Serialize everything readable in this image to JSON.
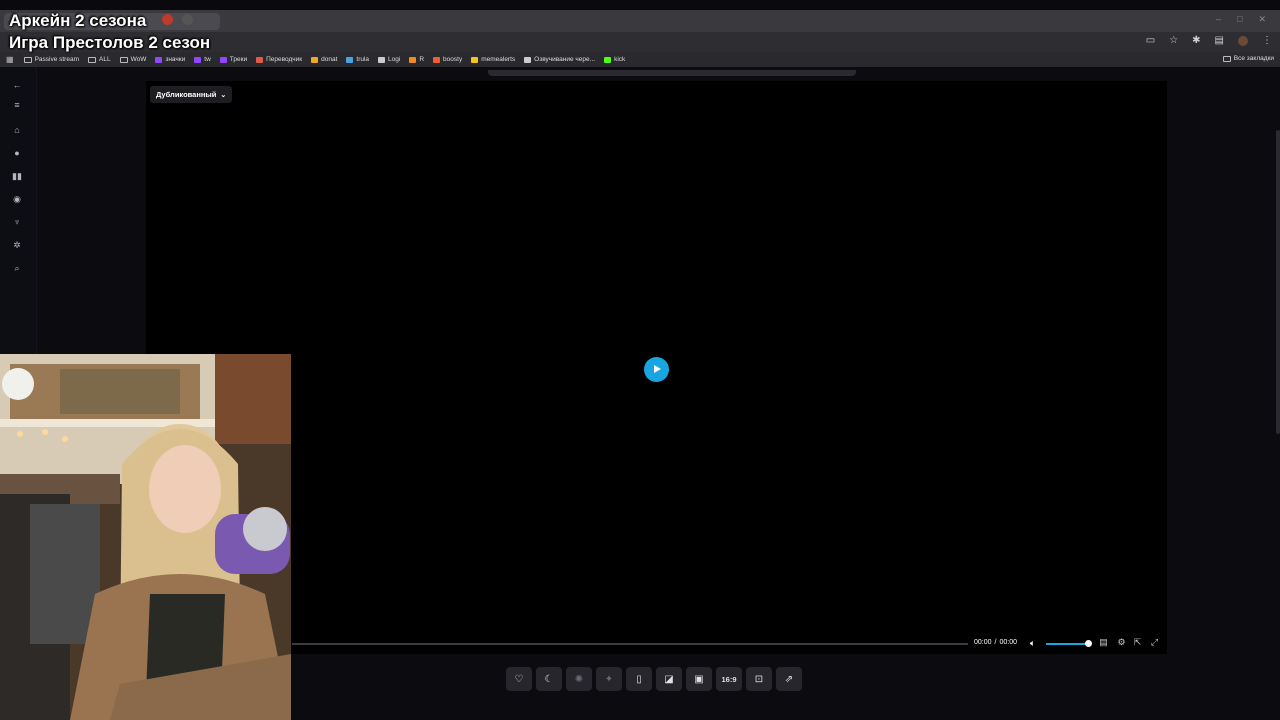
{
  "overlay": {
    "line1": "Аркейн 2 сезона",
    "line2": "Игра Престолов 2 сезон"
  },
  "browser": {
    "bookmarks": [
      {
        "label": "Passive stream",
        "icon": "folder-icon",
        "color": "#bbbbbb"
      },
      {
        "label": "ALL",
        "icon": "folder-icon",
        "color": "#bbbbbb"
      },
      {
        "label": "WoW",
        "icon": "folder-icon",
        "color": "#bbbbbb"
      },
      {
        "label": "значки",
        "icon": "twitch-icon",
        "color": "#9146ff"
      },
      {
        "label": "tw",
        "icon": "twitch-icon",
        "color": "#9146ff"
      },
      {
        "label": "Треки",
        "icon": "twitch-icon",
        "color": "#9146ff"
      },
      {
        "label": "Переводчик",
        "icon": "translate-icon",
        "color": "#e05a47"
      },
      {
        "label": "donat",
        "icon": "donat-icon",
        "color": "#f5a623"
      },
      {
        "label": "trula",
        "icon": "trula-icon",
        "color": "#4aa3df"
      },
      {
        "label": "Logi",
        "icon": "logi-icon",
        "color": "#cccccc"
      },
      {
        "label": "R",
        "icon": "r-icon",
        "color": "#f08a24"
      },
      {
        "label": "boosty",
        "icon": "boosty-icon",
        "color": "#f15f2c"
      },
      {
        "label": "memealerts",
        "icon": "memealerts-icon",
        "color": "#f5c518"
      },
      {
        "label": "Озвучивание чере...",
        "icon": "page-icon",
        "color": "#cccccc"
      },
      {
        "label": "kick",
        "icon": "kick-icon",
        "color": "#53fc18"
      }
    ],
    "all_bookmarks": "Все закладки"
  },
  "player": {
    "voice_select": "Дубликованный",
    "time_current": "00:00",
    "time_separator": "/",
    "time_total": "00:00",
    "volume": 1.0,
    "progress": 0.0,
    "accent_color": "#19a6e0"
  },
  "tools": {
    "aspect_label": "16:9"
  }
}
